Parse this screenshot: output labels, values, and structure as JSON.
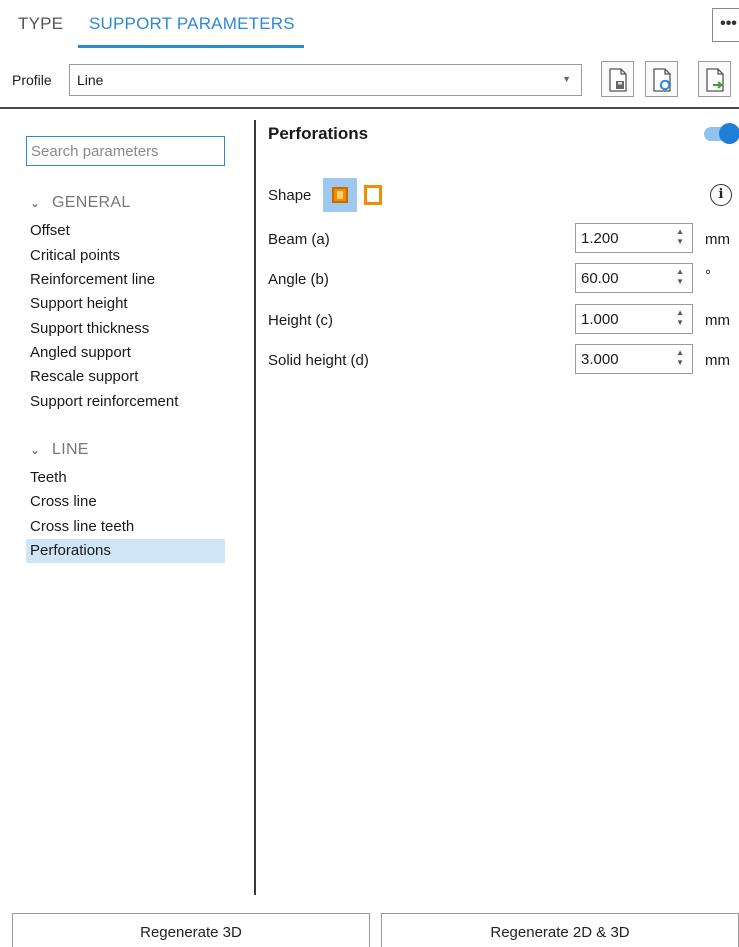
{
  "tabs": {
    "type": "TYPE",
    "support_parameters": "SUPPORT PARAMETERS"
  },
  "more_menu": "•••",
  "profile": {
    "label": "Profile",
    "value": "Line"
  },
  "search": {
    "placeholder": "Search parameters"
  },
  "groups": [
    {
      "title": "GENERAL",
      "items": [
        "Offset",
        "Critical points",
        "Reinforcement line",
        "Support height",
        "Support thickness",
        "Angled support",
        "Rescale support",
        "Support reinforcement"
      ]
    },
    {
      "title": "LINE",
      "items": [
        "Teeth",
        "Cross line",
        "Cross line teeth",
        "Perforations"
      ]
    }
  ],
  "selected_item": "Perforations",
  "section": {
    "title": "Perforations",
    "toggle_on": true
  },
  "shape": {
    "label": "Shape",
    "info_icon": "i"
  },
  "params": [
    {
      "label": "Beam (a)",
      "value": "1.200",
      "unit": "mm"
    },
    {
      "label": "Angle (b)",
      "value": "60.00",
      "unit": "°"
    },
    {
      "label": "Height (c)",
      "value": "1.000",
      "unit": "mm"
    },
    {
      "label": "Solid height (d)",
      "value": "3.000",
      "unit": "mm"
    }
  ],
  "buttons": {
    "regenerate_3d": "Regenerate 3D",
    "regenerate_2d_3d": "Regenerate 2D & 3D"
  },
  "colors": {
    "accent": "#2b8ad8",
    "selection": "#cfe5f8",
    "shape_orange": "#f28c00"
  }
}
